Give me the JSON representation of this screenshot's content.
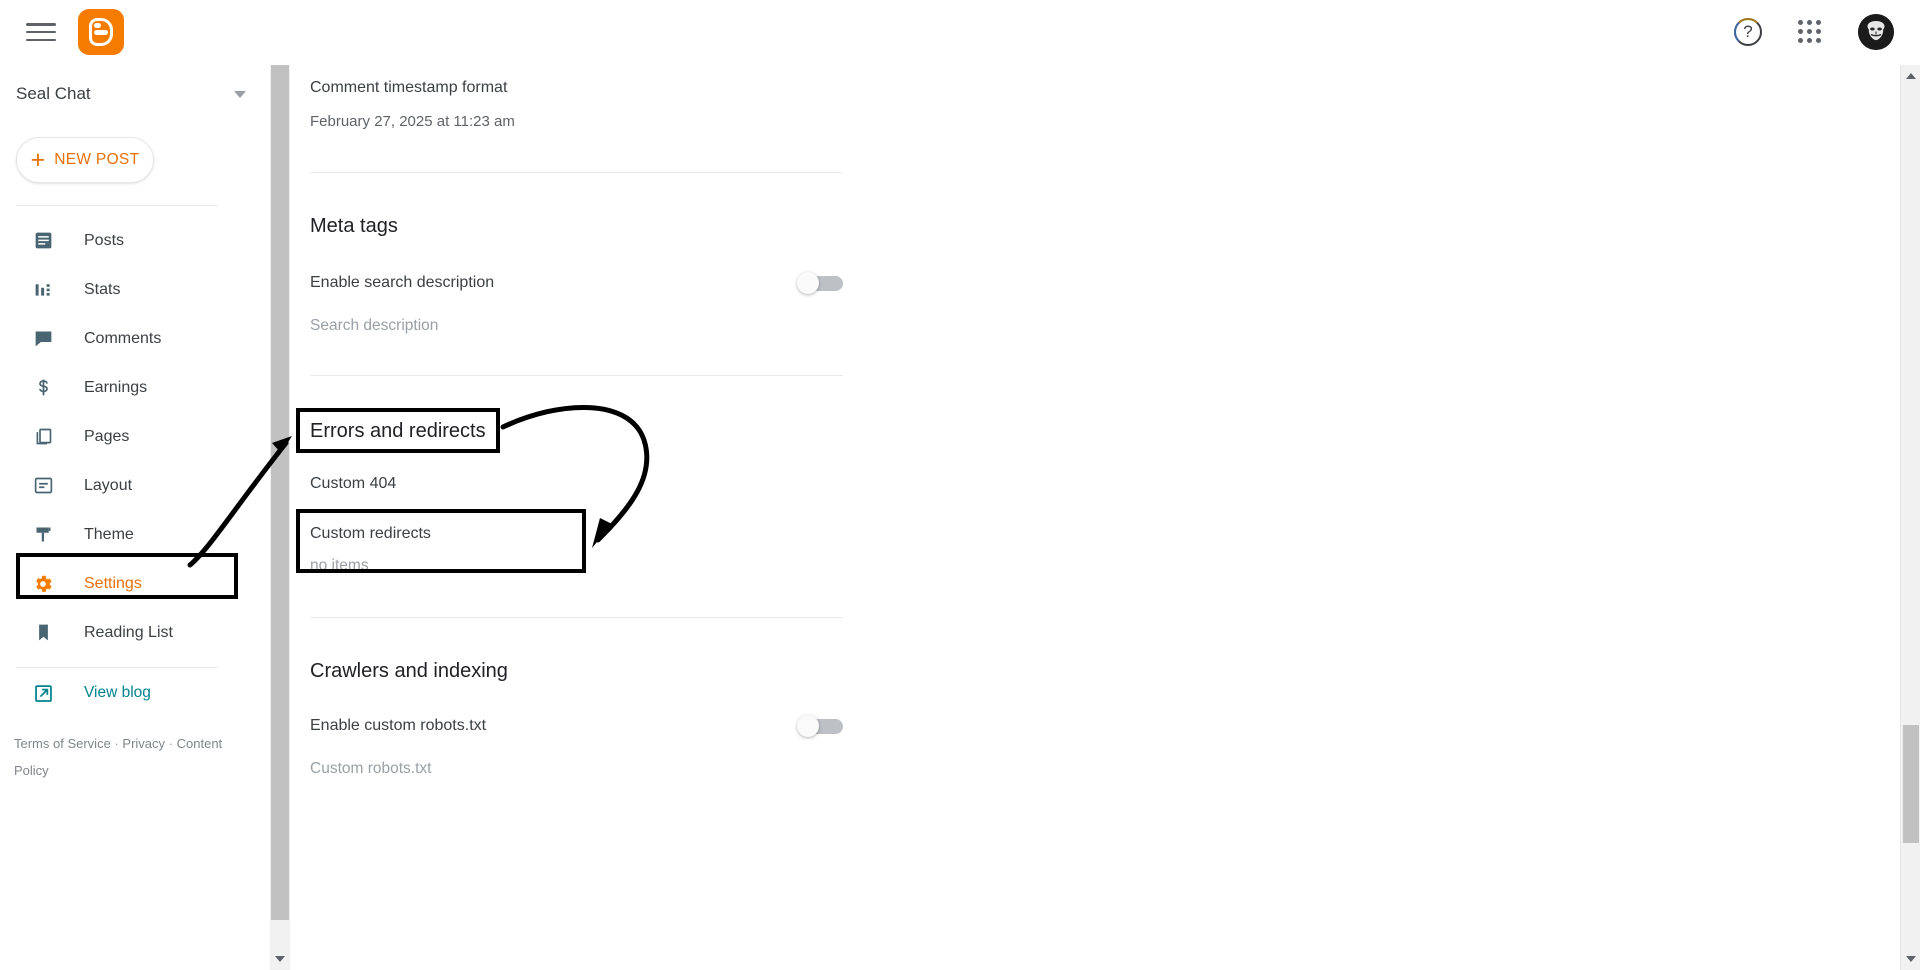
{
  "topbar": {
    "menu_icon": "hamburger-menu-icon",
    "logo_icon": "blogger-logo-icon",
    "help_icon": "help-icon",
    "help_glyph": "?",
    "apps_icon": "apps-grid-icon",
    "avatar_icon": "user-avatar"
  },
  "sidebar": {
    "blog_name": "Seal Chat",
    "blog_selector_icon": "chevron-down-icon",
    "new_post_label": "NEW POST",
    "new_post_plus": "+",
    "items": [
      {
        "label": "Posts",
        "icon": "posts-icon",
        "active": false
      },
      {
        "label": "Stats",
        "icon": "stats-icon",
        "active": false
      },
      {
        "label": "Comments",
        "icon": "comments-icon",
        "active": false
      },
      {
        "label": "Earnings",
        "icon": "earnings-icon",
        "active": false
      },
      {
        "label": "Pages",
        "icon": "pages-icon",
        "active": false
      },
      {
        "label": "Layout",
        "icon": "layout-icon",
        "active": false
      },
      {
        "label": "Theme",
        "icon": "theme-icon",
        "active": false
      },
      {
        "label": "Settings",
        "icon": "gear-icon",
        "active": true
      },
      {
        "label": "Reading List",
        "icon": "bookmark-icon",
        "active": false
      }
    ],
    "view_blog_label": "View blog",
    "view_blog_icon": "external-link-icon",
    "legal": {
      "terms": "Terms of Service",
      "privacy": "Privacy",
      "content_policy": "Content Policy",
      "separator": "·"
    }
  },
  "main": {
    "comment_timestamp": {
      "label": "Comment timestamp format",
      "value": "February 27, 2025 at 11:23 am"
    },
    "meta_tags": {
      "title": "Meta tags",
      "enable_label": "Enable search description",
      "enable_state": "off",
      "search_description_placeholder": "Search description"
    },
    "errors_redirects": {
      "title": "Errors and redirects",
      "custom_404_label": "Custom 404",
      "custom_redirects_label": "Custom redirects",
      "custom_redirects_value": "no items"
    },
    "crawlers": {
      "title": "Crawlers and indexing",
      "enable_label": "Enable custom robots.txt",
      "enable_state": "off",
      "robots_placeholder": "Custom robots.txt"
    }
  },
  "colors": {
    "brand_orange": "#f57c00",
    "accent_orange": "#e8710a",
    "teal": "#00838f",
    "icon_slate": "#4a6572",
    "text_primary": "#3c4043",
    "text_muted": "#9aa0a6",
    "annotation": "#000000"
  }
}
